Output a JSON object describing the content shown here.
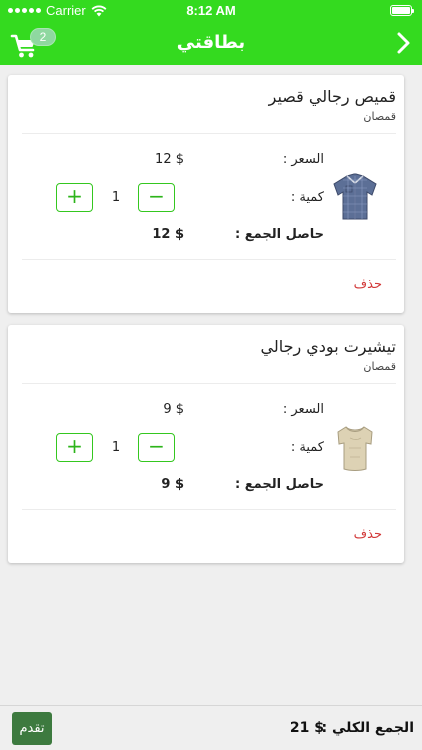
{
  "status_bar": {
    "carrier": "Carrier",
    "time": "8:12 AM"
  },
  "nav": {
    "title": "بطاقتي",
    "cart_count": "2"
  },
  "cart_items": [
    {
      "name": "قميص رجالي قصير",
      "category": "قمصان",
      "price_label": "السعر :",
      "price": "12 $",
      "quantity_label": "كمية :",
      "quantity": "1",
      "subtotal_label": "حاصل الجمع :",
      "subtotal": "12 $",
      "delete_label": "حذف",
      "minus_label": "−",
      "plus_label": "+"
    },
    {
      "name": "تيشيرت بودي رجالي",
      "category": "قمصان",
      "price_label": "السعر :",
      "price": "9 $",
      "quantity_label": "كمية :",
      "quantity": "1",
      "subtotal_label": "حاصل الجمع :",
      "subtotal": "9 $",
      "delete_label": "حذف",
      "minus_label": "−",
      "plus_label": "+"
    }
  ],
  "footer": {
    "total_label": "الجمع الكلي :",
    "total_value": "21 $",
    "checkout_label": "تقدم"
  },
  "colors": {
    "brand": "#34da1f",
    "button_border": "#34c71f",
    "checkout": "#3d7a3f",
    "delete": "#d23a3a"
  },
  "icons": [
    "wifi-icon",
    "cart-icon",
    "chevron-right-icon",
    "shirt-product-image",
    "tshirt-product-image"
  ]
}
